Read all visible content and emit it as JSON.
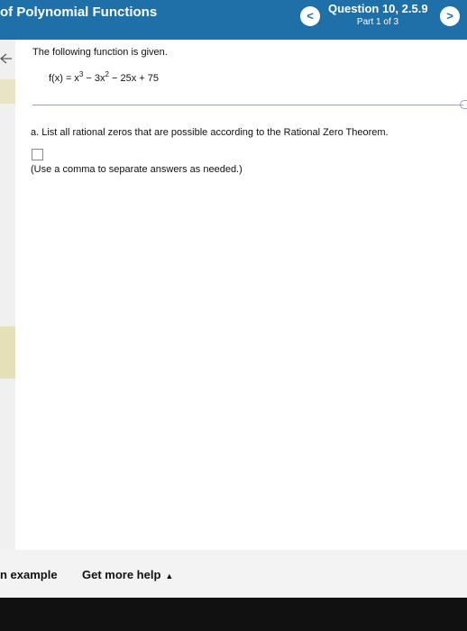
{
  "header": {
    "title": "of Polynomial Functions",
    "question_title": "Question 10, 2.5.9",
    "question_part": "Part 1 of 3",
    "prev_icon": "chevron-left-icon",
    "next_icon": "chevron-right-icon",
    "prev_glyph": "<",
    "next_glyph": ">",
    "background": "#1f6fa8"
  },
  "problem": {
    "intro": "The following function is given.",
    "formula": {
      "lhs": "f(x) = x",
      "exp1": "3",
      "mid": " − 3x",
      "exp2": "2",
      "rhs": " − 25x + 75"
    }
  },
  "part_a": {
    "prompt": "a. List all rational zeros that are possible according to the Rational Zero Theorem.",
    "answer_value": "",
    "hint": "(Use a comma to separate answers as needed.)"
  },
  "footer": {
    "example_label": "n example",
    "help_label": "Get more help",
    "help_arrow": "▲"
  }
}
